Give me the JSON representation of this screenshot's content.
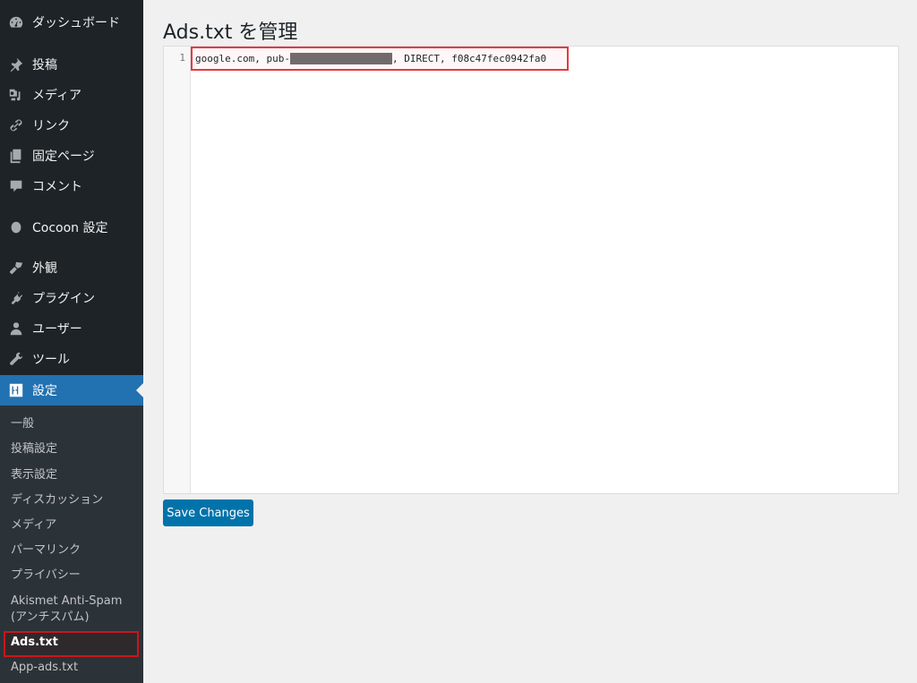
{
  "sidebar": {
    "items": [
      {
        "label": "ダッシュボード",
        "icon": "dashboard-icon"
      },
      {
        "label": "投稿",
        "icon": "pin-icon"
      },
      {
        "label": "メディア",
        "icon": "media-icon"
      },
      {
        "label": "リンク",
        "icon": "link-icon"
      },
      {
        "label": "固定ページ",
        "icon": "pages-icon"
      },
      {
        "label": "コメント",
        "icon": "comment-icon"
      },
      {
        "label": "Cocoon 設定",
        "icon": "circle-icon"
      },
      {
        "label": "外観",
        "icon": "brush-icon"
      },
      {
        "label": "プラグイン",
        "icon": "plugin-icon"
      },
      {
        "label": "ユーザー",
        "icon": "user-icon"
      },
      {
        "label": "ツール",
        "icon": "wrench-icon"
      },
      {
        "label": "設定",
        "icon": "settings-icon",
        "active": true
      }
    ],
    "submenu": [
      {
        "label": "一般"
      },
      {
        "label": "投稿設定"
      },
      {
        "label": "表示設定"
      },
      {
        "label": "ディスカッション"
      },
      {
        "label": "メディア"
      },
      {
        "label": "パーマリンク"
      },
      {
        "label": "プライバシー"
      },
      {
        "label": "Akismet Anti-Spam (アンチスパム)"
      },
      {
        "label": "Ads.txt",
        "current": true
      },
      {
        "label": "App-ads.txt"
      }
    ]
  },
  "main": {
    "title": "Ads.txt を管理",
    "editor": {
      "line_number": "1",
      "code_prefix": "google.com, pub-",
      "code_suffix": ", DIRECT, f08c47fec0942fa0"
    },
    "save_label": "Save Changes"
  },
  "colors": {
    "sidebar_bg": "#1d2327",
    "submenu_bg": "#2c3338",
    "active_bg": "#2271b1",
    "button_bg": "#0073aa",
    "highlight_red": "#e23a43"
  }
}
